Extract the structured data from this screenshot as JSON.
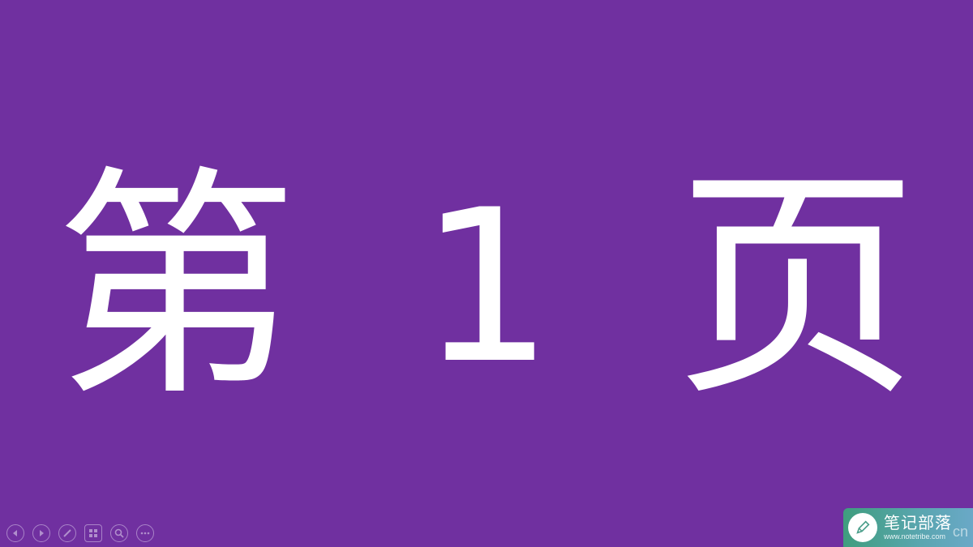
{
  "slide": {
    "title_part1": "第",
    "title_part2": "1",
    "title_part3": "页",
    "background_color": "#7030a0",
    "text_color": "#ffffff"
  },
  "controls": [
    {
      "name": "previous-slide-button",
      "icon": "chevron-left-icon"
    },
    {
      "name": "next-slide-button",
      "icon": "chevron-right-icon"
    },
    {
      "name": "pen-tool-button",
      "icon": "pen-icon"
    },
    {
      "name": "slide-overview-button",
      "icon": "grid-icon"
    },
    {
      "name": "zoom-button",
      "icon": "magnifier-icon"
    },
    {
      "name": "more-options-button",
      "icon": "ellipsis-icon"
    }
  ],
  "watermark": {
    "brand_cn": "笔记部落",
    "brand_url": "www.notetribe.com",
    "brand_suffix": "cn"
  }
}
